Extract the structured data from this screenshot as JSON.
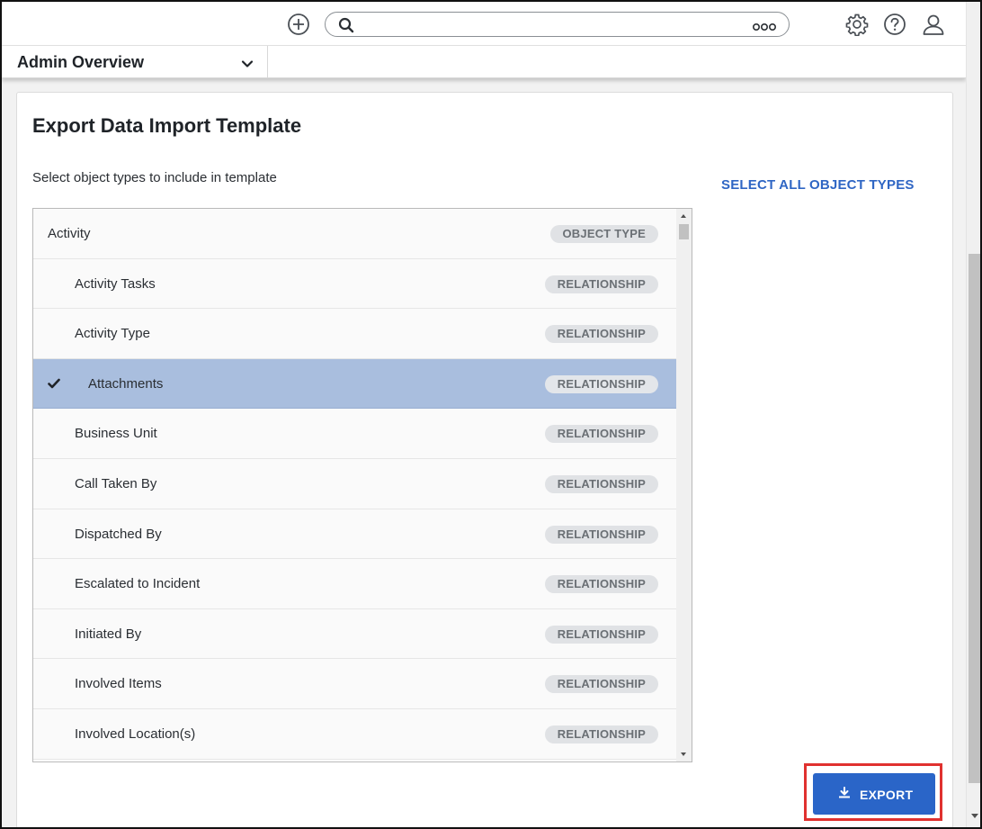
{
  "header": {
    "search_placeholder": "",
    "icons": {
      "add": "plus-circle-icon",
      "search": "search-icon",
      "more": "more-dots-icon",
      "settings": "gear-icon",
      "help": "help-circle-icon",
      "user": "user-icon"
    }
  },
  "subheader": {
    "dashboard_label": "Admin Overview"
  },
  "card": {
    "title": "Export Data Import Template",
    "instruction": "Select object types to include in template",
    "select_all_label": "SELECT ALL OBJECT TYPES"
  },
  "list": {
    "items": [
      {
        "name": "Activity",
        "type": "OBJECT TYPE",
        "selected": false
      },
      {
        "name": "Activity Tasks",
        "type": "RELATIONSHIP",
        "selected": false
      },
      {
        "name": "Activity Type",
        "type": "RELATIONSHIP",
        "selected": false
      },
      {
        "name": "Attachments",
        "type": "RELATIONSHIP",
        "selected": true
      },
      {
        "name": "Business Unit",
        "type": "RELATIONSHIP",
        "selected": false
      },
      {
        "name": "Call Taken By",
        "type": "RELATIONSHIP",
        "selected": false
      },
      {
        "name": "Dispatched By",
        "type": "RELATIONSHIP",
        "selected": false
      },
      {
        "name": "Escalated to Incident",
        "type": "RELATIONSHIP",
        "selected": false
      },
      {
        "name": "Initiated By",
        "type": "RELATIONSHIP",
        "selected": false
      },
      {
        "name": "Involved Items",
        "type": "RELATIONSHIP",
        "selected": false
      },
      {
        "name": "Involved Location(s)",
        "type": "RELATIONSHIP",
        "selected": false
      }
    ]
  },
  "export": {
    "label": "EXPORT",
    "icon": "download-icon"
  },
  "colors": {
    "accent": "#2a65c8",
    "selected_row": "#a9bede",
    "highlight": "#e0312f"
  }
}
